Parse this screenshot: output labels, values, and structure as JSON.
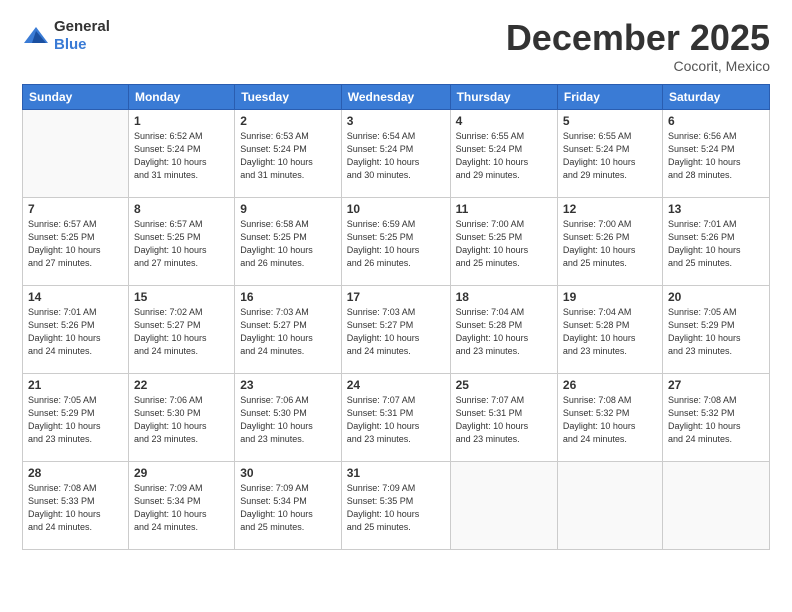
{
  "header": {
    "logo_general": "General",
    "logo_blue": "Blue",
    "title": "December 2025",
    "location": "Cocorit, Mexico"
  },
  "days_of_week": [
    "Sunday",
    "Monday",
    "Tuesday",
    "Wednesday",
    "Thursday",
    "Friday",
    "Saturday"
  ],
  "weeks": [
    [
      {
        "day": "",
        "info": ""
      },
      {
        "day": "1",
        "info": "Sunrise: 6:52 AM\nSunset: 5:24 PM\nDaylight: 10 hours\nand 31 minutes."
      },
      {
        "day": "2",
        "info": "Sunrise: 6:53 AM\nSunset: 5:24 PM\nDaylight: 10 hours\nand 31 minutes."
      },
      {
        "day": "3",
        "info": "Sunrise: 6:54 AM\nSunset: 5:24 PM\nDaylight: 10 hours\nand 30 minutes."
      },
      {
        "day": "4",
        "info": "Sunrise: 6:55 AM\nSunset: 5:24 PM\nDaylight: 10 hours\nand 29 minutes."
      },
      {
        "day": "5",
        "info": "Sunrise: 6:55 AM\nSunset: 5:24 PM\nDaylight: 10 hours\nand 29 minutes."
      },
      {
        "day": "6",
        "info": "Sunrise: 6:56 AM\nSunset: 5:24 PM\nDaylight: 10 hours\nand 28 minutes."
      }
    ],
    [
      {
        "day": "7",
        "info": "Sunrise: 6:57 AM\nSunset: 5:25 PM\nDaylight: 10 hours\nand 27 minutes."
      },
      {
        "day": "8",
        "info": "Sunrise: 6:57 AM\nSunset: 5:25 PM\nDaylight: 10 hours\nand 27 minutes."
      },
      {
        "day": "9",
        "info": "Sunrise: 6:58 AM\nSunset: 5:25 PM\nDaylight: 10 hours\nand 26 minutes."
      },
      {
        "day": "10",
        "info": "Sunrise: 6:59 AM\nSunset: 5:25 PM\nDaylight: 10 hours\nand 26 minutes."
      },
      {
        "day": "11",
        "info": "Sunrise: 7:00 AM\nSunset: 5:25 PM\nDaylight: 10 hours\nand 25 minutes."
      },
      {
        "day": "12",
        "info": "Sunrise: 7:00 AM\nSunset: 5:26 PM\nDaylight: 10 hours\nand 25 minutes."
      },
      {
        "day": "13",
        "info": "Sunrise: 7:01 AM\nSunset: 5:26 PM\nDaylight: 10 hours\nand 25 minutes."
      }
    ],
    [
      {
        "day": "14",
        "info": "Sunrise: 7:01 AM\nSunset: 5:26 PM\nDaylight: 10 hours\nand 24 minutes."
      },
      {
        "day": "15",
        "info": "Sunrise: 7:02 AM\nSunset: 5:27 PM\nDaylight: 10 hours\nand 24 minutes."
      },
      {
        "day": "16",
        "info": "Sunrise: 7:03 AM\nSunset: 5:27 PM\nDaylight: 10 hours\nand 24 minutes."
      },
      {
        "day": "17",
        "info": "Sunrise: 7:03 AM\nSunset: 5:27 PM\nDaylight: 10 hours\nand 24 minutes."
      },
      {
        "day": "18",
        "info": "Sunrise: 7:04 AM\nSunset: 5:28 PM\nDaylight: 10 hours\nand 23 minutes."
      },
      {
        "day": "19",
        "info": "Sunrise: 7:04 AM\nSunset: 5:28 PM\nDaylight: 10 hours\nand 23 minutes."
      },
      {
        "day": "20",
        "info": "Sunrise: 7:05 AM\nSunset: 5:29 PM\nDaylight: 10 hours\nand 23 minutes."
      }
    ],
    [
      {
        "day": "21",
        "info": "Sunrise: 7:05 AM\nSunset: 5:29 PM\nDaylight: 10 hours\nand 23 minutes."
      },
      {
        "day": "22",
        "info": "Sunrise: 7:06 AM\nSunset: 5:30 PM\nDaylight: 10 hours\nand 23 minutes."
      },
      {
        "day": "23",
        "info": "Sunrise: 7:06 AM\nSunset: 5:30 PM\nDaylight: 10 hours\nand 23 minutes."
      },
      {
        "day": "24",
        "info": "Sunrise: 7:07 AM\nSunset: 5:31 PM\nDaylight: 10 hours\nand 23 minutes."
      },
      {
        "day": "25",
        "info": "Sunrise: 7:07 AM\nSunset: 5:31 PM\nDaylight: 10 hours\nand 23 minutes."
      },
      {
        "day": "26",
        "info": "Sunrise: 7:08 AM\nSunset: 5:32 PM\nDaylight: 10 hours\nand 24 minutes."
      },
      {
        "day": "27",
        "info": "Sunrise: 7:08 AM\nSunset: 5:32 PM\nDaylight: 10 hours\nand 24 minutes."
      }
    ],
    [
      {
        "day": "28",
        "info": "Sunrise: 7:08 AM\nSunset: 5:33 PM\nDaylight: 10 hours\nand 24 minutes."
      },
      {
        "day": "29",
        "info": "Sunrise: 7:09 AM\nSunset: 5:34 PM\nDaylight: 10 hours\nand 24 minutes."
      },
      {
        "day": "30",
        "info": "Sunrise: 7:09 AM\nSunset: 5:34 PM\nDaylight: 10 hours\nand 25 minutes."
      },
      {
        "day": "31",
        "info": "Sunrise: 7:09 AM\nSunset: 5:35 PM\nDaylight: 10 hours\nand 25 minutes."
      },
      {
        "day": "",
        "info": ""
      },
      {
        "day": "",
        "info": ""
      },
      {
        "day": "",
        "info": ""
      }
    ]
  ]
}
